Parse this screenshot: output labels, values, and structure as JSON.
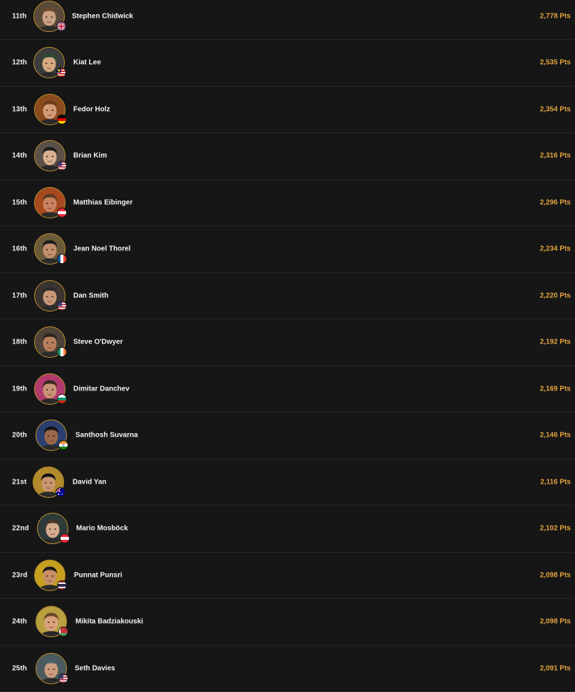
{
  "leaderboard": {
    "points_suffix": "Pts",
    "rows": [
      {
        "rank": "11th",
        "name": "Stephen Chidwick",
        "points": "2,778 Pts",
        "flag": "gb",
        "skin": "#c9a184",
        "hair": "#6b4a2f",
        "bg": "#5a4a3a"
      },
      {
        "rank": "12th",
        "name": "Kiat Lee",
        "points": "2,535 Pts",
        "flag": "my",
        "skin": "#d6a982",
        "hair": "#2b4a34",
        "bg": "#3c3c3c"
      },
      {
        "rank": "13th",
        "name": "Fedor Holz",
        "points": "2,354 Pts",
        "flag": "de",
        "skin": "#d39a76",
        "hair": "#6a3c1c",
        "bg": "#8a4a1e"
      },
      {
        "rank": "14th",
        "name": "Brian Kim",
        "points": "2,316 Pts",
        "flag": "us",
        "skin": "#d8b090",
        "hair": "#1c1c1c",
        "bg": "#5b5048"
      },
      {
        "rank": "15th",
        "name": "Matthias Eibinger",
        "points": "2,296 Pts",
        "flag": "at",
        "skin": "#c98260",
        "hair": "#5b3a22",
        "bg": "#a84a20"
      },
      {
        "rank": "16th",
        "name": "Jean Noel Thorel",
        "points": "2,234 Pts",
        "flag": "fr",
        "skin": "#c28e6c",
        "hair": "#1d1d1d",
        "bg": "#6b5a3a"
      },
      {
        "rank": "17th",
        "name": "Dan Smith",
        "points": "2,220 Pts",
        "flag": "us",
        "skin": "#c79878",
        "hair": "#2a2a2a",
        "bg": "#3a3330"
      },
      {
        "rank": "18th",
        "name": "Steve O'Dwyer",
        "points": "2,192 Pts",
        "flag": "ie",
        "skin": "#b77f5c",
        "hair": "#2c2520",
        "bg": "#4e4236"
      },
      {
        "rank": "19th",
        "name": "Dimitar Danchev",
        "points": "2,169 Pts",
        "flag": "bg",
        "skin": "#c99476",
        "hair": "#3a2a20",
        "bg": "#b23a6e"
      },
      {
        "rank": "20th",
        "name": "Santhosh Suvarna",
        "points": "2,146 Pts",
        "flag": "in",
        "skin": "#9a6848",
        "hair": "#151515",
        "bg": "#2c3f70"
      },
      {
        "rank": "21st",
        "name": "David Yan",
        "points": "2,116 Pts",
        "flag": "au",
        "skin": "#c99670",
        "hair": "#121212",
        "bg": "#b28a2c"
      },
      {
        "rank": "22nd",
        "name": "Mario Mosböck",
        "points": "2,102 Pts",
        "flag": "at",
        "skin": "#d6ab90",
        "hair": "#4a3526",
        "bg": "#2c3a3a"
      },
      {
        "rank": "23rd",
        "name": "Punnat Punsri",
        "points": "2,098 Pts",
        "flag": "th",
        "skin": "#c89066",
        "hair": "#1a1a1a",
        "bg": "#c8a020"
      },
      {
        "rank": "24th",
        "name": "Mikita Badziakouski",
        "points": "2,098 Pts",
        "flag": "by",
        "skin": "#d9a27c",
        "hair": "#6a4a2a",
        "bg": "#b8a040"
      },
      {
        "rank": "25th",
        "name": "Seth Davies",
        "points": "2,091 Pts",
        "flag": "us",
        "skin": "#cc9c7c",
        "hair": "#48606a",
        "bg": "#4a5a5e"
      }
    ]
  }
}
